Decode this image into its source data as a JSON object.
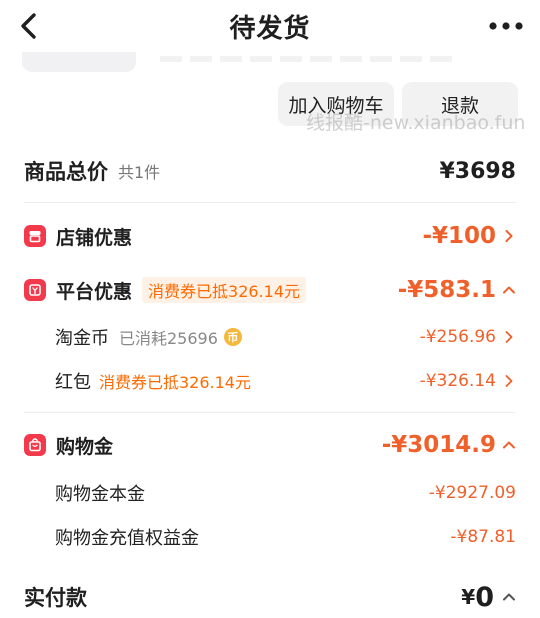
{
  "header": {
    "title": "待发货"
  },
  "actions": {
    "add_to_cart": "加入购物车",
    "refund": "退款"
  },
  "watermark": "线报酷-new.xianbao.fun",
  "total": {
    "label": "商品总价",
    "count": "共1件",
    "value": "¥3698"
  },
  "store_discount": {
    "label": "店铺优惠",
    "value": "-¥100"
  },
  "platform_discount": {
    "label": "平台优惠",
    "tag": "消费券已抵326.14元",
    "value": "-¥583.1",
    "items": [
      {
        "label": "淘金币",
        "note": "已消耗25696",
        "coin_glyph": "币",
        "value": "-¥256.96"
      },
      {
        "label": "红包",
        "tag": "消费券已抵326.14元",
        "value": "-¥326.14"
      }
    ]
  },
  "shopping_credit": {
    "label": "购物金",
    "value": "-¥3014.9",
    "items": [
      {
        "label": "购物金本金",
        "value": "-¥2927.09"
      },
      {
        "label": "购物金充值权益金",
        "value": "-¥87.81"
      }
    ]
  },
  "paid": {
    "label": "实付款",
    "currency": "¥",
    "amount": "0"
  },
  "colors": {
    "accent": "#f0602a",
    "icon_red": "#f23a4c",
    "tag_bg": "#fff1e6"
  }
}
